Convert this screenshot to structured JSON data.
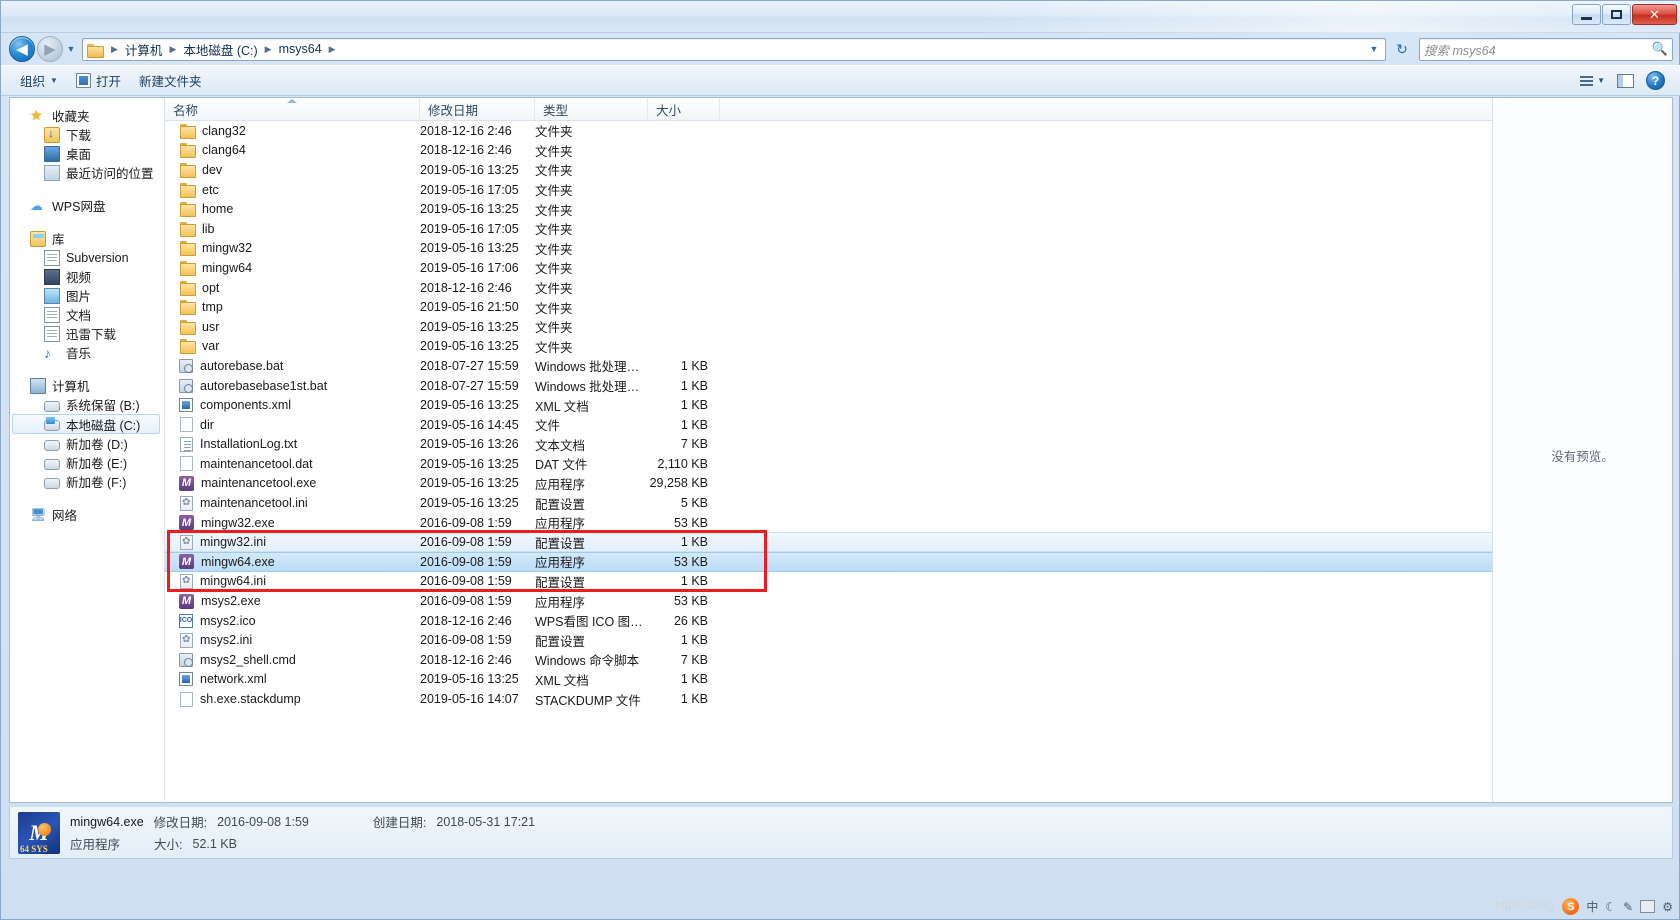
{
  "window": {
    "controls": {
      "minimize": "–",
      "maximize": "□",
      "close": "✕"
    }
  },
  "address": {
    "back_label": "◀",
    "forward_label": "▶",
    "history_caret": "▼",
    "crumbs": [
      "计算机",
      "本地磁盘 (C:)",
      "msys64"
    ],
    "separator": "▶",
    "dropdown_caret": "▼",
    "refresh_label": "↻"
  },
  "search": {
    "placeholder": "搜索 msys64",
    "icon": "search-icon"
  },
  "toolbar": {
    "organize_label": "组织",
    "organize_caret": "▼",
    "open_label": "打开",
    "new_folder_label": "新建文件夹",
    "view_caret": "▼",
    "help_label": "?"
  },
  "sidebar": {
    "groups": [
      {
        "header": {
          "label": "收藏夹",
          "icon": "star-icon"
        },
        "items": [
          {
            "label": "下载",
            "icon": "downloads-icon"
          },
          {
            "label": "桌面",
            "icon": "desktop-icon"
          },
          {
            "label": "最近访问的位置",
            "icon": "recent-places-icon"
          }
        ]
      },
      {
        "header": {
          "label": "WPS网盘",
          "icon": "cloud-icon"
        },
        "items": []
      },
      {
        "header": {
          "label": "库",
          "icon": "library-icon"
        },
        "items": [
          {
            "label": "Subversion",
            "icon": "document-icon"
          },
          {
            "label": "视频",
            "icon": "video-icon"
          },
          {
            "label": "图片",
            "icon": "pictures-icon"
          },
          {
            "label": "文档",
            "icon": "documents-icon"
          },
          {
            "label": "迅雷下载",
            "icon": "thunder-download-icon"
          },
          {
            "label": "音乐",
            "icon": "music-icon"
          }
        ]
      },
      {
        "header": {
          "label": "计算机",
          "icon": "computer-icon"
        },
        "items": [
          {
            "label": "系统保留 (B:)",
            "icon": "drive-icon",
            "selected": false
          },
          {
            "label": "本地磁盘 (C:)",
            "icon": "system-drive-icon",
            "selected": true
          },
          {
            "label": "新加卷 (D:)",
            "icon": "drive-icon",
            "selected": false
          },
          {
            "label": "新加卷 (E:)",
            "icon": "drive-icon",
            "selected": false
          },
          {
            "label": "新加卷 (F:)",
            "icon": "drive-icon",
            "selected": false
          }
        ]
      },
      {
        "header": {
          "label": "网络",
          "icon": "network-icon"
        },
        "items": []
      }
    ]
  },
  "filelist": {
    "columns": [
      "名称",
      "修改日期",
      "类型",
      "大小"
    ],
    "sorted_column": "名称",
    "rows": [
      {
        "name": "clang32",
        "date": "2018-12-16 2:46",
        "type": "文件夹",
        "size": "",
        "icon": "folder-icon"
      },
      {
        "name": "clang64",
        "date": "2018-12-16 2:46",
        "type": "文件夹",
        "size": "",
        "icon": "folder-icon"
      },
      {
        "name": "dev",
        "date": "2019-05-16 13:25",
        "type": "文件夹",
        "size": "",
        "icon": "folder-icon"
      },
      {
        "name": "etc",
        "date": "2019-05-16 17:05",
        "type": "文件夹",
        "size": "",
        "icon": "folder-icon"
      },
      {
        "name": "home",
        "date": "2019-05-16 13:25",
        "type": "文件夹",
        "size": "",
        "icon": "folder-icon"
      },
      {
        "name": "lib",
        "date": "2019-05-16 17:05",
        "type": "文件夹",
        "size": "",
        "icon": "folder-icon"
      },
      {
        "name": "mingw32",
        "date": "2019-05-16 13:25",
        "type": "文件夹",
        "size": "",
        "icon": "folder-icon"
      },
      {
        "name": "mingw64",
        "date": "2019-05-16 17:06",
        "type": "文件夹",
        "size": "",
        "icon": "folder-icon"
      },
      {
        "name": "opt",
        "date": "2018-12-16 2:46",
        "type": "文件夹",
        "size": "",
        "icon": "folder-icon"
      },
      {
        "name": "tmp",
        "date": "2019-05-16 21:50",
        "type": "文件夹",
        "size": "",
        "icon": "folder-icon"
      },
      {
        "name": "usr",
        "date": "2019-05-16 13:25",
        "type": "文件夹",
        "size": "",
        "icon": "folder-icon"
      },
      {
        "name": "var",
        "date": "2019-05-16 13:25",
        "type": "文件夹",
        "size": "",
        "icon": "folder-icon"
      },
      {
        "name": "autorebase.bat",
        "date": "2018-07-27 15:59",
        "type": "Windows 批处理…",
        "size": "1 KB",
        "icon": "batch-file-icon"
      },
      {
        "name": "autorebasebase1st.bat",
        "date": "2018-07-27 15:59",
        "type": "Windows 批处理…",
        "size": "1 KB",
        "icon": "batch-file-icon"
      },
      {
        "name": "components.xml",
        "date": "2019-05-16 13:25",
        "type": "XML 文档",
        "size": "1 KB",
        "icon": "xml-file-icon"
      },
      {
        "name": "dir",
        "date": "2019-05-16 14:45",
        "type": "文件",
        "size": "1 KB",
        "icon": "generic-file-icon"
      },
      {
        "name": "InstallationLog.txt",
        "date": "2019-05-16 13:26",
        "type": "文本文档",
        "size": "7 KB",
        "icon": "text-file-icon"
      },
      {
        "name": "maintenancetool.dat",
        "date": "2019-05-16 13:25",
        "type": "DAT 文件",
        "size": "2,110 KB",
        "icon": "generic-file-icon"
      },
      {
        "name": "maintenancetool.exe",
        "date": "2019-05-16 13:25",
        "type": "应用程序",
        "size": "29,258 KB",
        "icon": "exe-file-icon"
      },
      {
        "name": "maintenancetool.ini",
        "date": "2019-05-16 13:25",
        "type": "配置设置",
        "size": "5 KB",
        "icon": "ini-file-icon"
      },
      {
        "name": "mingw32.exe",
        "date": "2016-09-08 1:59",
        "type": "应用程序",
        "size": "53 KB",
        "icon": "exe-file-icon"
      },
      {
        "name": "mingw32.ini",
        "date": "2016-09-08 1:59",
        "type": "配置设置",
        "size": "1 KB",
        "icon": "ini-file-icon",
        "state": "hover"
      },
      {
        "name": "mingw64.exe",
        "date": "2016-09-08 1:59",
        "type": "应用程序",
        "size": "53 KB",
        "icon": "exe-file-icon",
        "state": "selected"
      },
      {
        "name": "mingw64.ini",
        "date": "2016-09-08 1:59",
        "type": "配置设置",
        "size": "1 KB",
        "icon": "ini-file-icon"
      },
      {
        "name": "msys2.exe",
        "date": "2016-09-08 1:59",
        "type": "应用程序",
        "size": "53 KB",
        "icon": "exe-file-icon"
      },
      {
        "name": "msys2.ico",
        "date": "2018-12-16 2:46",
        "type": "WPS看图 ICO 图…",
        "size": "26 KB",
        "icon": "ico-file-icon"
      },
      {
        "name": "msys2.ini",
        "date": "2016-09-08 1:59",
        "type": "配置设置",
        "size": "1 KB",
        "icon": "ini-file-icon"
      },
      {
        "name": "msys2_shell.cmd",
        "date": "2018-12-16 2:46",
        "type": "Windows 命令脚本",
        "size": "7 KB",
        "icon": "batch-file-icon"
      },
      {
        "name": "network.xml",
        "date": "2019-05-16 13:25",
        "type": "XML 文档",
        "size": "1 KB",
        "icon": "xml-file-icon"
      },
      {
        "name": "sh.exe.stackdump",
        "date": "2019-05-16 14:07",
        "type": "STACKDUMP 文件",
        "size": "1 KB",
        "icon": "generic-file-icon"
      }
    ]
  },
  "preview": {
    "text": "没有预览。"
  },
  "statusbar": {
    "file_name": "mingw64.exe",
    "modified_label": "修改日期:",
    "modified_value": "2016-09-08 1:59",
    "created_label": "创建日期:",
    "created_value": "2018-05-31 17:21",
    "type_value": "应用程序",
    "size_label": "大小:",
    "size_value": "52.1 KB",
    "icon_letter": "M",
    "icon_sub": "64 SYS"
  },
  "watermark": {
    "text": "https://blog."
  },
  "tray": {
    "ime_label": "中",
    "items": [
      "S",
      "中",
      "☽",
      "⌨",
      "▤",
      "⚙"
    ]
  },
  "colors": {
    "selection_blue": "#bcdcf6",
    "annotation_red": "#ee1c1c",
    "accent": "#2a8ad4"
  }
}
